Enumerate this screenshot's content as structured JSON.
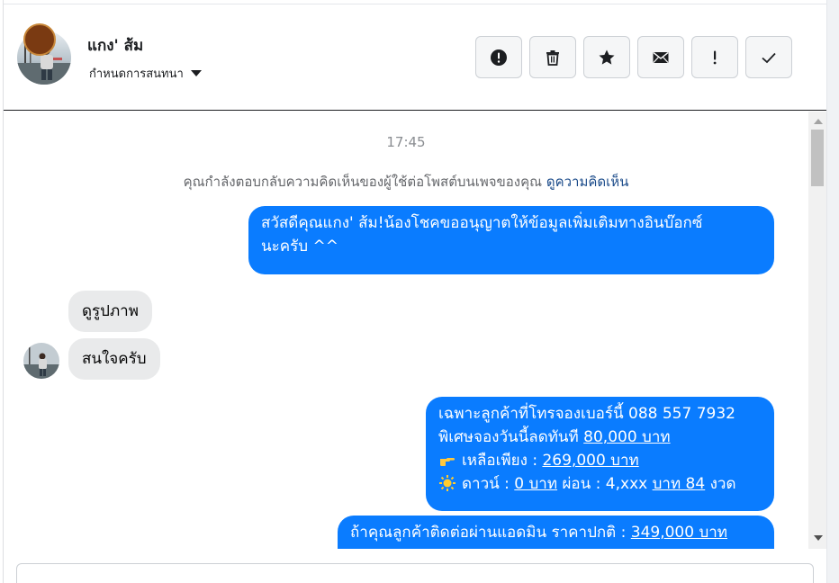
{
  "header": {
    "contact_name": "แกง' ส้ม",
    "assign_label": "กำหนดการสนทนา",
    "actions": [
      {
        "name": "mark-spam-button",
        "icon": "alert-circle-icon"
      },
      {
        "name": "delete-button",
        "icon": "trash-icon"
      },
      {
        "name": "star-button",
        "icon": "star-icon"
      },
      {
        "name": "mark-unread-button",
        "icon": "envelope-icon"
      },
      {
        "name": "follow-up-button",
        "icon": "exclamation-icon"
      },
      {
        "name": "mark-done-button",
        "icon": "check-icon"
      }
    ]
  },
  "conversation": {
    "timestamp": "17:45",
    "notice_text": "คุณกำลังตอบกลับความคิดเห็นของผู้ใช้ต่อโพสต์บนเพจของคุณ",
    "notice_link": "ดูความคิดเห็น",
    "messages": {
      "m1": {
        "line1": "สวัสดีคุณแกง' ส้ม!น้องโชคขออนุญาตให้ข้อมูลเพิ่มเติมทางอินบ๊อกซ์",
        "line2": "นะครับ ^^"
      },
      "m2": "ดูรูปภาพ",
      "m3": "สนใจครับ",
      "m4": {
        "line1": "เฉพาะลูกค้าที่โทรจองเบอร์นี้ 088 557 7932",
        "line2_prefix": "พิเศษจองวันนี้ลดทันที",
        "line2_amount": "80,000 บาท",
        "line3_prefix": "เหลือเพียง :",
        "line3_amount": "269,000 บาท",
        "line4_down_label": "ดาวน์ :",
        "line4_down_amount": "0 บาท",
        "line4_installment": "ผ่อน : 4,xxx",
        "line4_months": "บาท 84",
        "line4_suffix": "งวด"
      },
      "m5": {
        "line1_prefix": "ถ้าคุณลูกค้าติดต่อผ่านแอดมิน  ราคาปกติ :",
        "line1_amount": "349,000 บาท"
      }
    }
  },
  "colors": {
    "outgoing_bubble": "#0a7cff",
    "incoming_bubble": "#e9eaeb",
    "link": "#1b4b8a"
  }
}
